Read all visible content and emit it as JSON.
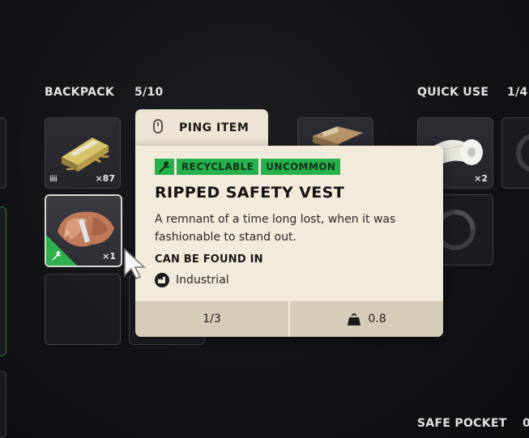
{
  "backpack": {
    "label": "BACKPACK",
    "count": "5/10"
  },
  "quick_use": {
    "label": "QUICK USE",
    "count": "1/4"
  },
  "safe_pocket": {
    "label": "SAFE POCKET",
    "count": "0"
  },
  "slots": {
    "ammo_qty": "×87",
    "ammo_glyph": "iiiii",
    "vest_qty": "×1",
    "bandage_qty": "×2"
  },
  "ping": {
    "label": "PING ITEM",
    "icon": "mouse-icon"
  },
  "tooltip": {
    "badges": [
      "RECYCLABLE",
      "UNCOMMON"
    ],
    "title": "RIPPED SAFETY VEST",
    "description": "A remnant of a time long lost, when it was fashionable to stand out.",
    "found_in_label": "CAN BE FOUND IN",
    "location": "Industrial",
    "stack": "1/3",
    "weight": "0.8"
  },
  "colors": {
    "uncommon": "#25b24a",
    "tooltip_bg": "#f2eadb",
    "tooltip_footer": "#d7ccb7",
    "background": "#121317"
  }
}
